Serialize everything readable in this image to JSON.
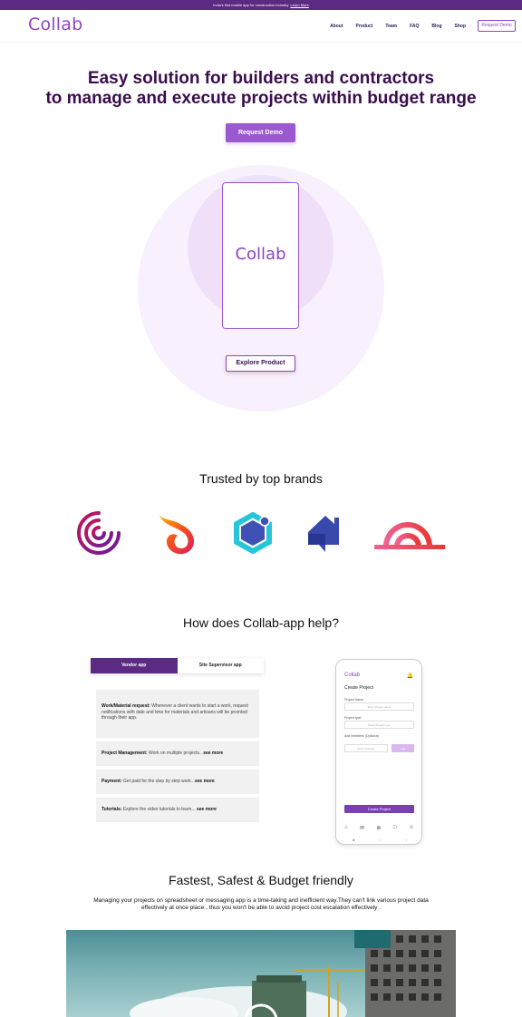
{
  "announcement": {
    "text": "India's first mobile app for construction industry.",
    "link": "Learn More"
  },
  "header": {
    "logo": "Collab",
    "nav": [
      "About",
      "Product",
      "Team",
      "FAQ",
      "Blog",
      "Shop"
    ],
    "cta": "Request Demo"
  },
  "hero": {
    "title_line1": "Easy solution for builders and contractors",
    "title_line2": "to manage and execute projects within budget range",
    "cta": "Request Demo",
    "phone_logo": "Collab",
    "explore": "Explore Product"
  },
  "brands": {
    "title": "Trusted by top brands"
  },
  "how": {
    "title": "How does Collab-app help?",
    "tabs": [
      "Vendor app",
      "Site Supervisor app"
    ],
    "cards": [
      {
        "title": "Work/Material request:",
        "text": " Whenever a client wants to start a work, request notifications with date and time for materials and artisans will be promted through their app."
      },
      {
        "title": "Project Management:",
        "text": " Work on multiple projects...",
        "more": "see more"
      },
      {
        "title": "Payment:",
        "text": " Get paid for the step by step work...",
        "more": "see more"
      },
      {
        "title": "Tutorials:",
        "text": " Explore the video tutorials to learn... ",
        "more": "see more"
      }
    ],
    "mockup": {
      "logo": "Collab",
      "heading": "Create Project",
      "name_label": "Project Name",
      "name_placeholder": "Enter Project name",
      "type_label": "Project type",
      "type_placeholder": "Select Project type",
      "members_label": "Add members (Optional)",
      "members_placeholder": "Enter Number",
      "add_label": "Add",
      "create_label": "Create Project"
    }
  },
  "fastest": {
    "title": "Fastest, Safest & Budget friendly",
    "text": "Managing your projects on spreadsheet  or messaging app is a time-taking and inefficient way.They can't link various project data effectively at once place , thus you won't be able to avoid project cost escalation effectively ."
  },
  "colors": {
    "primary": "#8e44c2",
    "dark": "#5b2a82",
    "title": "#3a0d4e"
  }
}
